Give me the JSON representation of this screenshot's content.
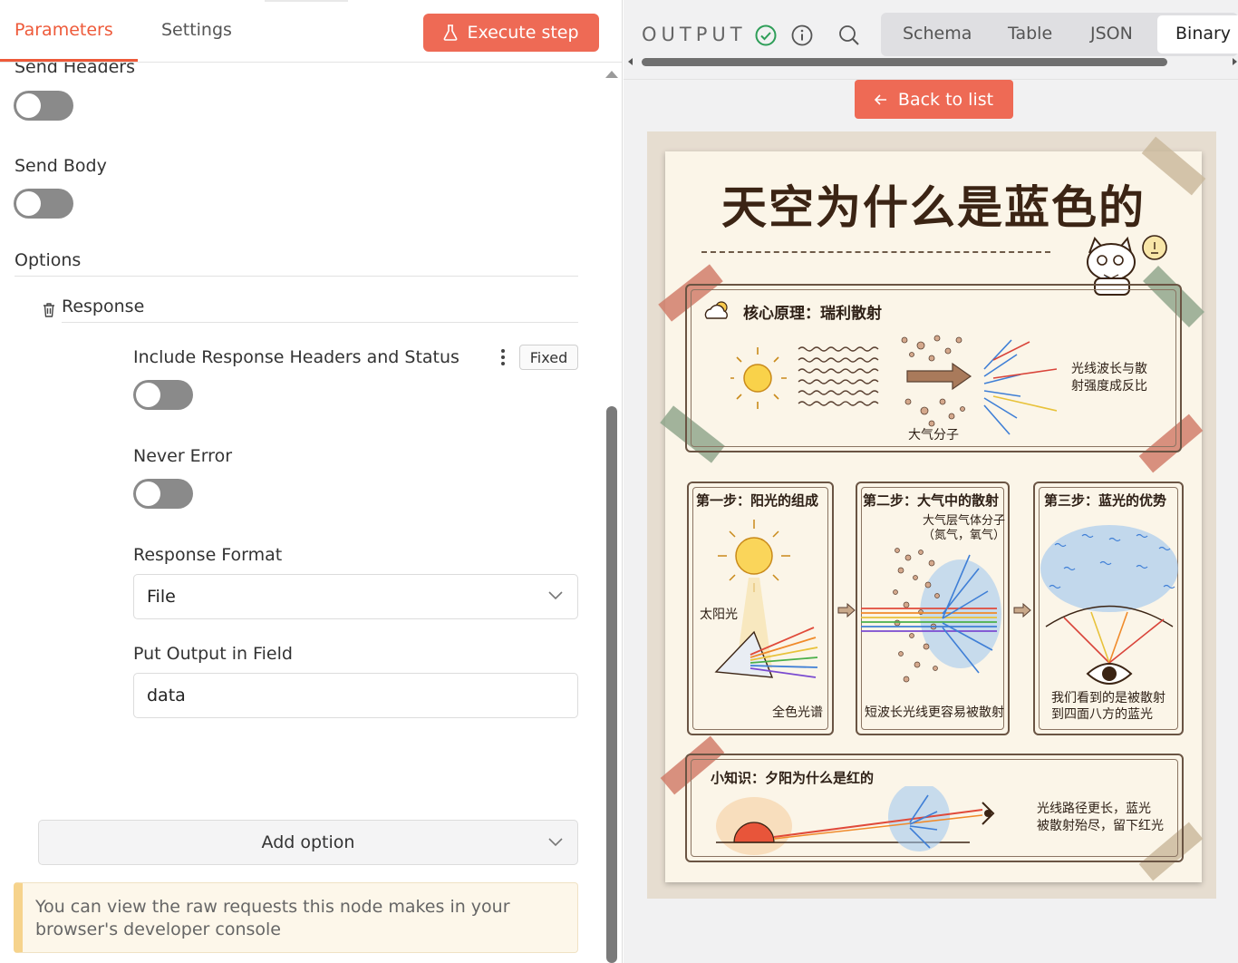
{
  "left_panel": {
    "tabs": {
      "parameters": "Parameters",
      "settings": "Settings"
    },
    "execute_button": "Execute step",
    "send_headers_label": "Send Headers",
    "send_body_label": "Send Body",
    "options_label": "Options",
    "response_label": "Response",
    "include_headers_label": "Include Response Headers and Status",
    "fixed_badge": "Fixed",
    "never_error_label": "Never Error",
    "response_format_label": "Response Format",
    "response_format_value": "File",
    "put_output_label": "Put Output in Field",
    "put_output_value": "data",
    "add_option_label": "Add option",
    "notice_text": "You can view the raw requests this node makes in your browser's developer console"
  },
  "right_panel": {
    "output_label": "OUTPUT",
    "view_tabs": [
      "Schema",
      "Table",
      "JSON",
      "Binary"
    ],
    "active_view": "Binary",
    "back_button": "Back to list",
    "poster": {
      "title": "天空为什么是蓝色的",
      "core_title": "核心原理：瑞利散射",
      "core_note_1": "光线波长与散",
      "core_note_2": "射强度成反比",
      "molecules": "大气分子",
      "step1_title": "第一步：阳光的组成",
      "step1_sun": "太阳光",
      "step1_spectrum": "全色光谱",
      "step2_title": "第二步：大气中的散射",
      "step2_note_1": "大气层气体分子",
      "step2_note_2": "（氮气，氧气）",
      "step2_caption": "短波长光线更容易被散射",
      "step3_title": "第三步：蓝光的优势",
      "step3_caption_1": "我们看到的是被散射",
      "step3_caption_2": "到四面八方的蓝光",
      "tip_title": "小知识：夕阳为什么是红的",
      "tip_note_1": "光线路径更长，蓝光",
      "tip_note_2": "被散射殆尽，留下红光"
    }
  },
  "colors": {
    "accent": "#ee6a55",
    "toggle_off": "#8a8a8a",
    "notice_bg": "#fdf7ea",
    "success": "#2e9e58"
  }
}
